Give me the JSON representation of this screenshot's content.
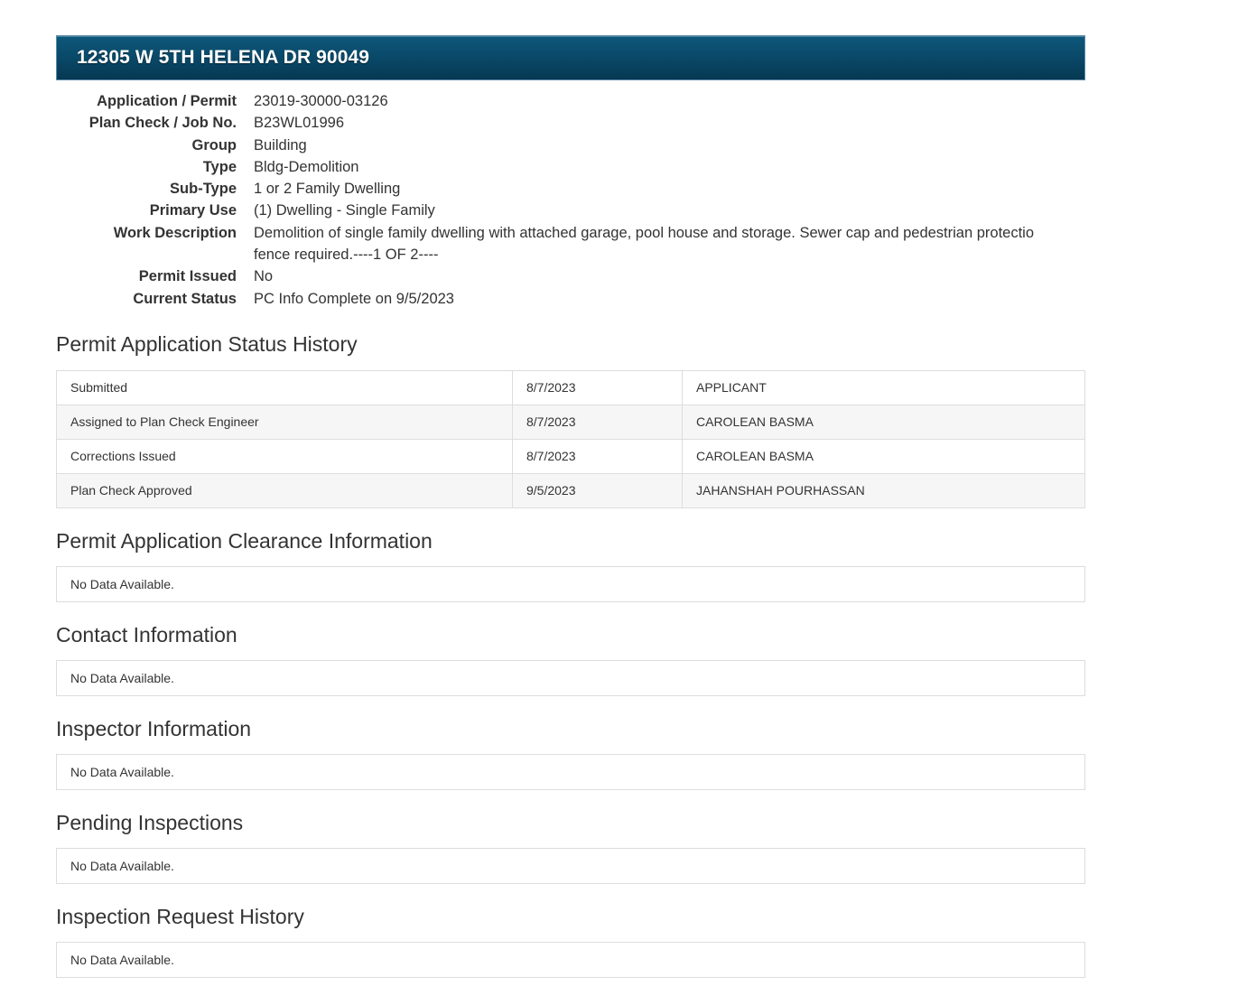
{
  "header": {
    "address": "12305 W 5TH HELENA DR 90049"
  },
  "details": [
    {
      "label": "Application / Permit",
      "value": "23019-30000-03126"
    },
    {
      "label": "Plan Check / Job No.",
      "value": "B23WL01996"
    },
    {
      "label": "Group",
      "value": "Building"
    },
    {
      "label": "Type",
      "value": "Bldg-Demolition"
    },
    {
      "label": "Sub-Type",
      "value": "1 or 2 Family Dwelling"
    },
    {
      "label": "Primary Use",
      "value": "(1) Dwelling - Single Family"
    },
    {
      "label": "Work Description",
      "value": "Demolition of single family dwelling with attached garage, pool house and storage. Sewer cap and pedestrian protectio fence required.----1 OF 2----"
    },
    {
      "label": "Permit Issued",
      "value": "No"
    },
    {
      "label": "Current Status",
      "value": "PC Info Complete on 9/5/2023"
    }
  ],
  "status_history": {
    "title": "Permit Application Status History",
    "rows": [
      {
        "event": "Submitted",
        "date": "8/7/2023",
        "person": "APPLICANT"
      },
      {
        "event": "Assigned to Plan Check Engineer",
        "date": "8/7/2023",
        "person": "CAROLEAN BASMA"
      },
      {
        "event": "Corrections Issued",
        "date": "8/7/2023",
        "person": "CAROLEAN BASMA"
      },
      {
        "event": "Plan Check Approved",
        "date": "9/5/2023",
        "person": "JAHANSHAH POURHASSAN"
      }
    ]
  },
  "sections": [
    {
      "title": "Permit Application Clearance Information",
      "message": "No Data Available."
    },
    {
      "title": "Contact Information",
      "message": "No Data Available."
    },
    {
      "title": "Inspector Information",
      "message": "No Data Available."
    },
    {
      "title": "Pending Inspections",
      "message": "No Data Available."
    },
    {
      "title": "Inspection Request History",
      "message": "No Data Available."
    }
  ]
}
